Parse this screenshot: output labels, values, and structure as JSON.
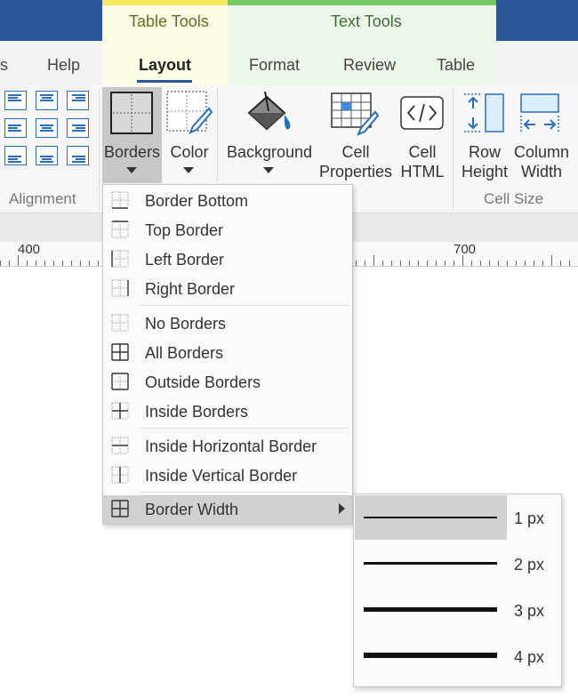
{
  "context_groups": {
    "table_tools": "Table Tools",
    "text_tools": "Text Tools"
  },
  "tabs": [
    {
      "label": "s"
    },
    {
      "label": "Help"
    },
    {
      "label": "Layout",
      "active": true
    },
    {
      "label": "Format"
    },
    {
      "label": "Review"
    },
    {
      "label": "Table"
    }
  ],
  "ribbon": {
    "alignment_label": "Alignment",
    "borders_label": "Borders",
    "color_label": "Color",
    "background_label": "Background",
    "cell_properties_line1": "Cell",
    "cell_properties_line2": "Properties",
    "cell_html_line1": "Cell",
    "cell_html_line2": "HTML",
    "row_height_line1": "Row",
    "row_height_line2": "Height",
    "column_width_line1": "Column",
    "column_width_line2": "Width",
    "cell_size_label": "Cell Size"
  },
  "ruler": {
    "mark_400": "400",
    "mark_700": "700"
  },
  "menu": {
    "items": [
      {
        "label": "Border Bottom",
        "icon": "border-bottom-icon"
      },
      {
        "label": "Top Border",
        "icon": "border-top-icon"
      },
      {
        "label": "Left Border",
        "icon": "border-left-icon"
      },
      {
        "label": "Right Border",
        "icon": "border-right-icon"
      },
      {
        "label": "No Borders",
        "icon": "border-none-icon"
      },
      {
        "label": "All Borders",
        "icon": "border-all-icon"
      },
      {
        "label": "Outside Borders",
        "icon": "border-outside-icon"
      },
      {
        "label": "Inside Borders",
        "icon": "border-inside-icon"
      },
      {
        "label": "Inside Horizontal Border",
        "icon": "border-inside-horizontal-icon"
      },
      {
        "label": "Inside Vertical Border",
        "icon": "border-inside-vertical-icon"
      },
      {
        "label": "Border Width",
        "icon": "border-width-icon",
        "highlighted": true
      }
    ]
  },
  "border_width_submenu": {
    "items": [
      {
        "label": "1 px",
        "width": 1,
        "highlighted": true
      },
      {
        "label": "2 px",
        "width": 2
      },
      {
        "label": "3 px",
        "width": 3
      },
      {
        "label": "4 px",
        "width": 4
      }
    ]
  },
  "colors": {
    "accent": "#2b579a",
    "icon_blue": "#2b6fb8",
    "highlight": "#d1d1d1"
  }
}
